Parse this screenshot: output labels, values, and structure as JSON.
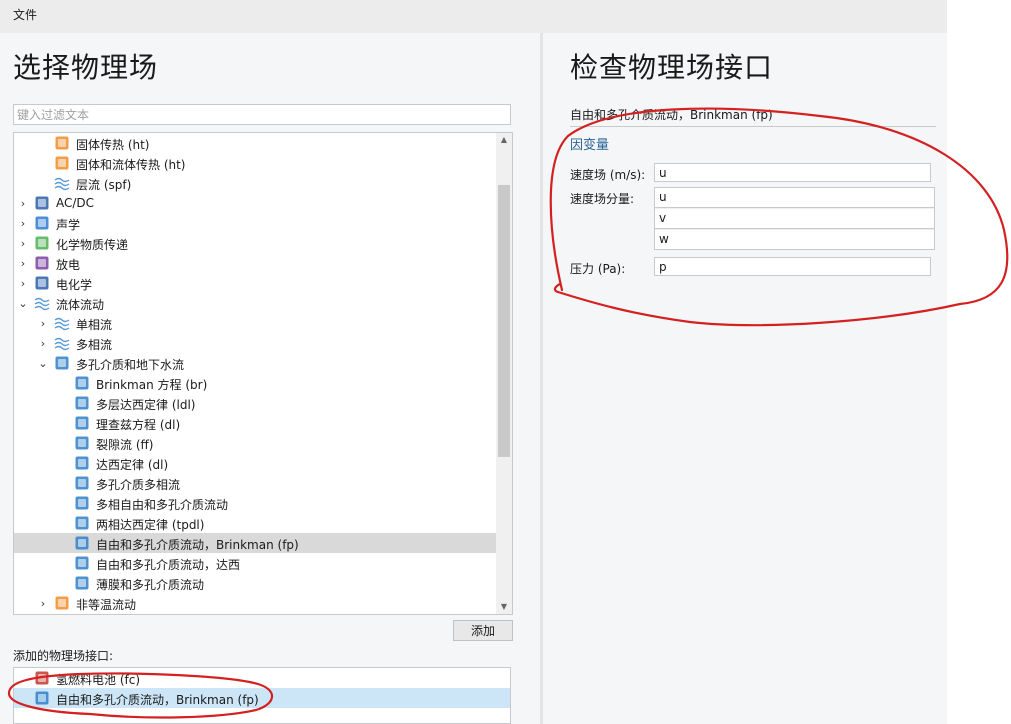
{
  "menu": {
    "file": "文件"
  },
  "left_pane": {
    "title": "选择物理场",
    "filter_placeholder": "键入过滤文本",
    "tree": [
      {
        "label": "固体传热 (ht)",
        "level": 2,
        "expander": "",
        "icon": "solid-heat-icon"
      },
      {
        "label": "固体和流体传热 (ht)",
        "level": 2,
        "expander": "",
        "icon": "solid-fluid-heat-icon"
      },
      {
        "label": "层流 (spf)",
        "level": 2,
        "expander": "",
        "icon": "laminar-flow-icon"
      },
      {
        "label": "AC/DC",
        "level": 1,
        "expander": "collapsed",
        "icon": "acdc-icon"
      },
      {
        "label": "声学",
        "level": 1,
        "expander": "collapsed",
        "icon": "acoustics-icon"
      },
      {
        "label": "化学物质传递",
        "level": 1,
        "expander": "collapsed",
        "icon": "chemical-species-icon"
      },
      {
        "label": "放电",
        "level": 1,
        "expander": "collapsed",
        "icon": "plasma-icon"
      },
      {
        "label": "电化学",
        "level": 1,
        "expander": "collapsed",
        "icon": "electrochemistry-icon"
      },
      {
        "label": "流体流动",
        "level": 1,
        "expander": "expanded",
        "icon": "fluid-flow-icon"
      },
      {
        "label": "单相流",
        "level": 2,
        "expander": "collapsed",
        "icon": "single-phase-flow-icon"
      },
      {
        "label": "多相流",
        "level": 2,
        "expander": "collapsed",
        "icon": "multiphase-flow-icon"
      },
      {
        "label": "多孔介质和地下水流",
        "level": 2,
        "expander": "expanded",
        "icon": "porous-media-icon"
      },
      {
        "label": "Brinkman 方程 (br)",
        "level": 3,
        "expander": "",
        "icon": "brinkman-icon"
      },
      {
        "label": "多层达西定律 (ldl)",
        "level": 3,
        "expander": "",
        "icon": "layered-darcy-icon"
      },
      {
        "label": "理查兹方程 (dl)",
        "level": 3,
        "expander": "",
        "icon": "richards-icon"
      },
      {
        "label": "裂隙流 (ff)",
        "level": 3,
        "expander": "",
        "icon": "fracture-flow-icon"
      },
      {
        "label": "达西定律 (dl)",
        "level": 3,
        "expander": "",
        "icon": "darcy-icon"
      },
      {
        "label": "多孔介质多相流",
        "level": 3,
        "expander": "",
        "icon": "porous-multiphase-icon"
      },
      {
        "label": "多相自由和多孔介质流动",
        "level": 3,
        "expander": "",
        "icon": "multiphase-free-porous-icon"
      },
      {
        "label": "两相达西定律 (tpdl)",
        "level": 3,
        "expander": "",
        "icon": "two-phase-darcy-icon"
      },
      {
        "label": "自由和多孔介质流动，Brinkman (fp)",
        "level": 3,
        "expander": "",
        "icon": "free-porous-brinkman-icon",
        "selected": true
      },
      {
        "label": "自由和多孔介质流动，达西",
        "level": 3,
        "expander": "",
        "icon": "free-porous-darcy-icon"
      },
      {
        "label": "薄膜和多孔介质流动",
        "level": 3,
        "expander": "",
        "icon": "thin-film-porous-icon"
      },
      {
        "label": "非等温流动",
        "level": 2,
        "expander": "collapsed",
        "icon": "nonisothermal-flow-icon"
      }
    ],
    "add_button": "添加",
    "added_label": "添加的物理场接口:",
    "added": [
      {
        "label": "氢燃料电池 (fc)",
        "icon": "fuel-cell-icon",
        "selected": false
      },
      {
        "label": "自由和多孔介质流动，Brinkman (fp)",
        "icon": "free-porous-brinkman-icon",
        "selected": true
      }
    ]
  },
  "right_pane": {
    "title": "检查物理场接口",
    "interface_name": "自由和多孔介质流动，Brinkman (fp)",
    "dependent_vars_title": "因变量",
    "velocity_label": "速度场 (m/s):",
    "velocity_value": "u",
    "components_label": "速度场分量:",
    "components": [
      "u",
      "v",
      "w"
    ],
    "pressure_label": "压力 (Pa):",
    "pressure_value": "p"
  },
  "colors": {
    "pane_bg": "#f5f6f7",
    "selection_gray": "#d9d9d9",
    "selection_blue": "#cde6f7",
    "link_blue": "#2a6496",
    "annotation_red": "#d42020"
  }
}
